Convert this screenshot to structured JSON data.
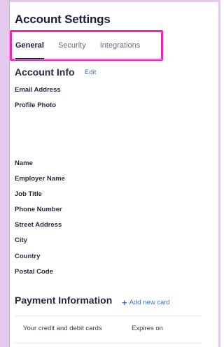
{
  "page": {
    "title": "Account Settings"
  },
  "tabs": [
    {
      "label": "General",
      "active": true
    },
    {
      "label": "Security",
      "active": false
    },
    {
      "label": "Integrations",
      "active": false
    }
  ],
  "account_info": {
    "title": "Account Info",
    "edit_label": "Edit",
    "fields": [
      "Email Address",
      "Profile Photo",
      "Name",
      "Employer Name",
      "Job Title",
      "Phone Number",
      "Street Address",
      "City",
      "Country",
      "Postal Code"
    ]
  },
  "payment": {
    "title": "Payment Information",
    "add_card_label": "Add new card",
    "columns": [
      "Your credit and debit cards",
      "Expires on"
    ]
  },
  "colors": {
    "accent": "#3b6fd4",
    "highlight": "#ee28b4",
    "frame": "#e3c9ec",
    "text_dark": "#231942"
  },
  "icons": {
    "add_card": "plus-icon"
  }
}
